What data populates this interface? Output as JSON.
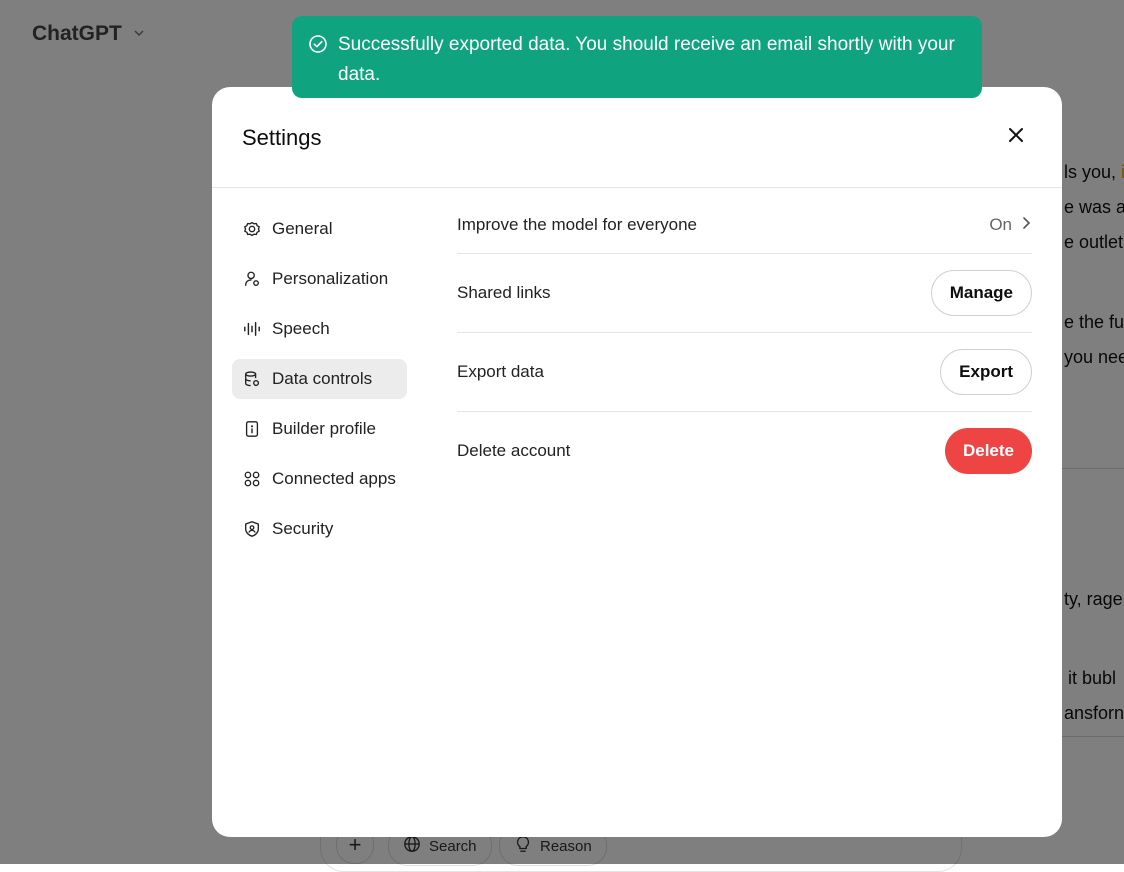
{
  "app": {
    "title": "ChatGPT"
  },
  "background": {
    "snippets": [
      {
        "text": "ls you, ",
        "accent": "i"
      },
      {
        "text": "e was a "
      },
      {
        "text": "e outlet"
      },
      {
        "text": "e the fu"
      },
      {
        "text": "you nee"
      },
      {
        "text": "ty, rage"
      },
      {
        "text": "it bubl"
      },
      {
        "text": "ansforn"
      }
    ],
    "composer": {
      "search_label": "Search",
      "reason_label": "Reason"
    }
  },
  "toast": {
    "message": "Successfully exported data. You should receive an email shortly with your data."
  },
  "settings": {
    "title": "Settings",
    "nav": [
      {
        "label": "General",
        "icon": "gear-icon"
      },
      {
        "label": "Personalization",
        "icon": "person-icon"
      },
      {
        "label": "Speech",
        "icon": "waveform-icon"
      },
      {
        "label": "Data controls",
        "icon": "database-icon",
        "active": true
      },
      {
        "label": "Builder profile",
        "icon": "id-badge-icon"
      },
      {
        "label": "Connected apps",
        "icon": "apps-grid-icon"
      },
      {
        "label": "Security",
        "icon": "shield-icon"
      }
    ],
    "rows": {
      "improve": {
        "label": "Improve the model for everyone",
        "value": "On"
      },
      "shared": {
        "label": "Shared links",
        "button": "Manage"
      },
      "export": {
        "label": "Export data",
        "button": "Export"
      },
      "delete": {
        "label": "Delete account",
        "button": "Delete"
      }
    }
  },
  "colors": {
    "toast_bg": "#10a37f",
    "danger": "#ef4444",
    "active_nav_bg": "#ececec"
  }
}
